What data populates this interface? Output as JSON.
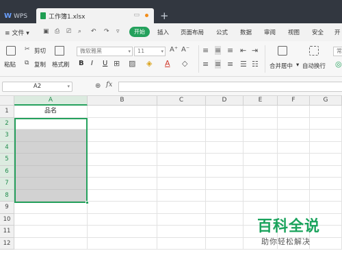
{
  "titlebar": {
    "home_tab": "WPS",
    "doc_tab": "工作簿1.xlsx",
    "add_tab": "+"
  },
  "menubar": {
    "file": "≡ 文件",
    "file_arrow": "▾",
    "start": "开始",
    "tabs": [
      "插入",
      "页面布局",
      "公式",
      "数据",
      "审阅",
      "视图",
      "安全",
      "开"
    ]
  },
  "ribbon": {
    "paste": "粘贴",
    "cut": "剪切",
    "copy": "复制",
    "format_painter": "格式刷",
    "font_name": "微软雅黑",
    "font_size": "11",
    "bold": "B",
    "italic": "I",
    "underline": "U",
    "merge": "合并居中",
    "wrap": "自动换行",
    "number_format": "常"
  },
  "formula_bar": {
    "name_box": "A2",
    "fx": "fx",
    "formula": ""
  },
  "sheet": {
    "columns": [
      "A",
      "B",
      "C",
      "D",
      "E",
      "F",
      "G"
    ],
    "rows": [
      "1",
      "2",
      "3",
      "4",
      "5",
      "6",
      "7",
      "8",
      "9",
      "10",
      "11",
      "12"
    ],
    "a1": "品名",
    "active_cell": "A2",
    "selection": "A2:A8"
  },
  "watermark": {
    "title": "百科全说",
    "subtitle": "助你轻松解决"
  },
  "colors": {
    "accent": "#24a15c",
    "titlebar": "#323740",
    "selection_fill": "#d2d2d2"
  }
}
